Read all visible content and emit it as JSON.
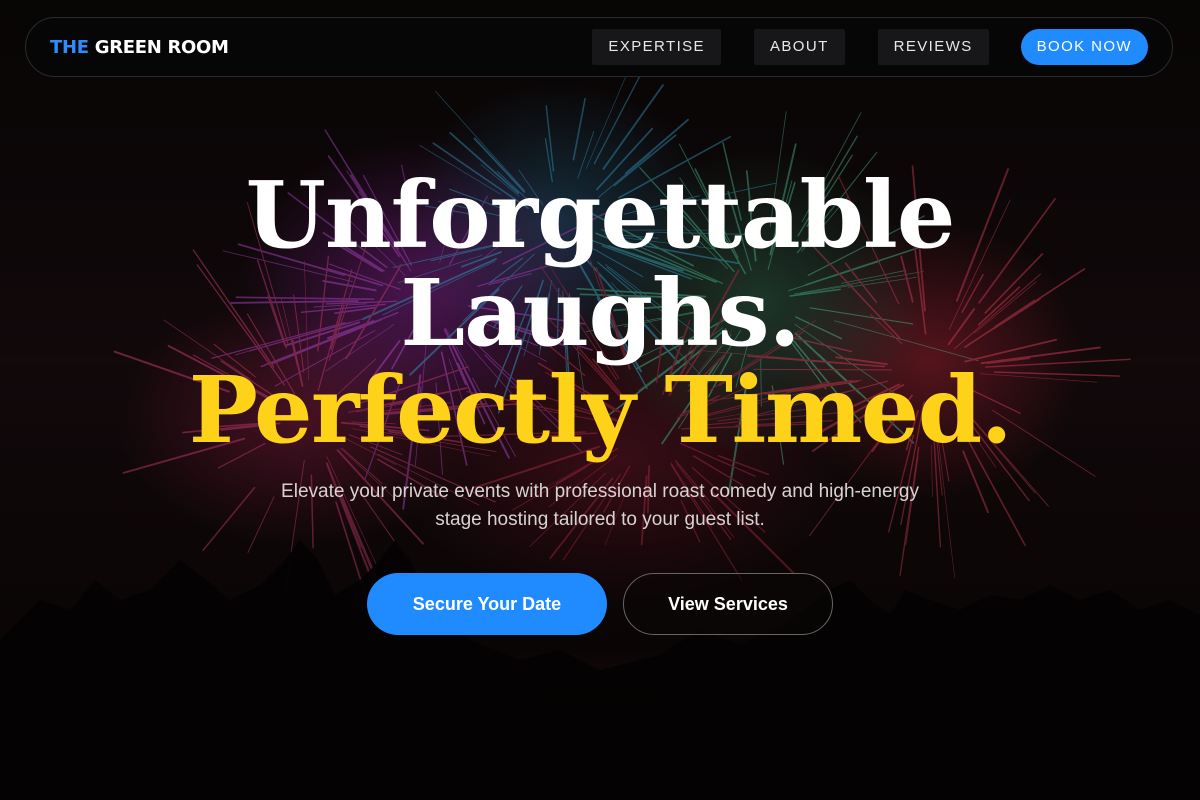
{
  "nav": {
    "logo_accent": "THE",
    "logo_rest": " GREEN ROOM",
    "links": [
      "EXPERTISE",
      "ABOUT",
      "REVIEWS"
    ],
    "cta": "BOOK NOW"
  },
  "hero": {
    "headline_line1": "Unforgettable",
    "headline_line2": "Laughs.",
    "headline_line3": "Perfectly Timed.",
    "subtitle": "Elevate your private events with professional roast comedy and high-energy stage hosting tailored to your guest list.",
    "primary_button": "Secure Your Date",
    "secondary_button": "View Services"
  },
  "colors": {
    "accent_blue": "#1f8bff",
    "headline_yellow": "#ffd21a",
    "background": "#0b0606"
  }
}
